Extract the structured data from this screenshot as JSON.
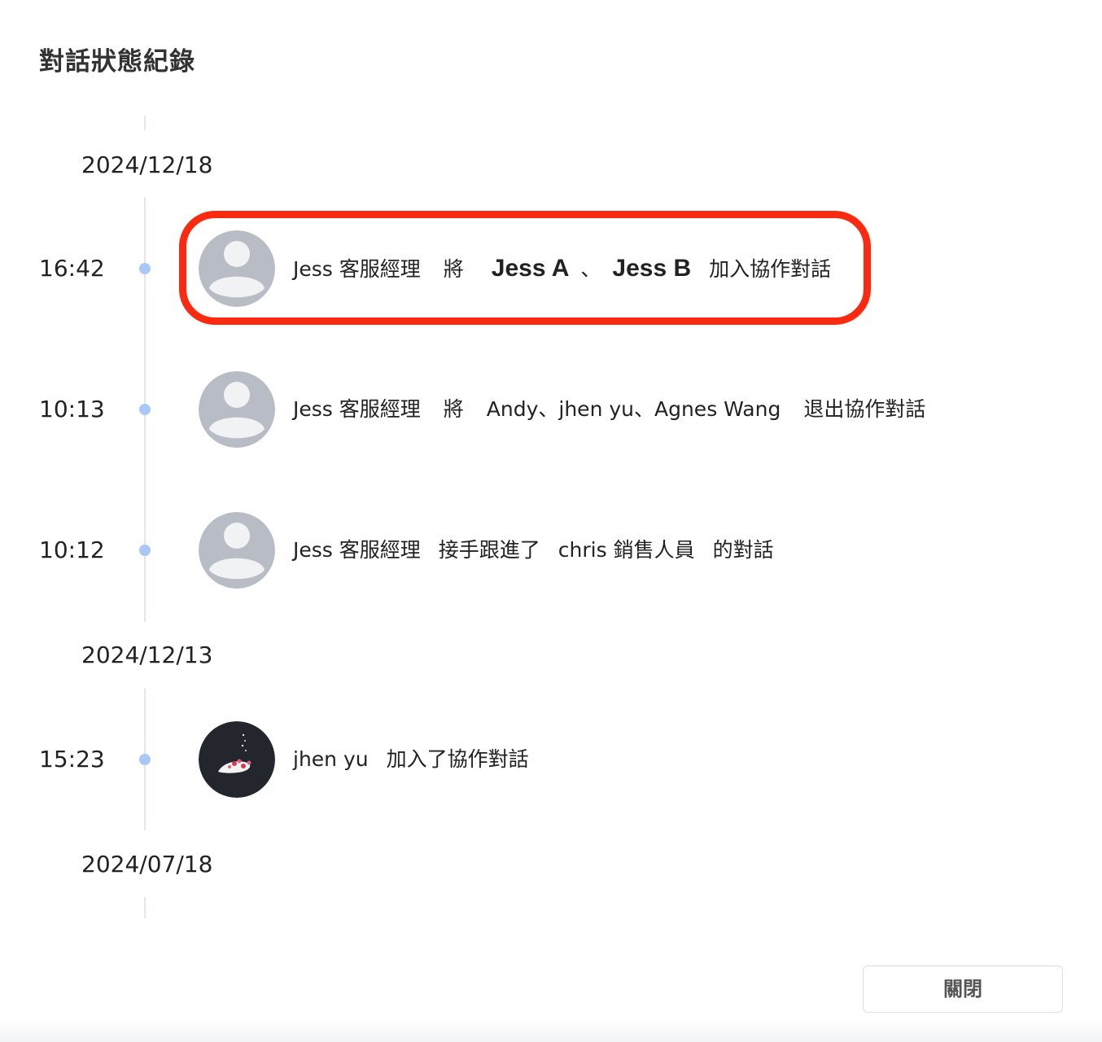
{
  "dialog": {
    "title": "對話狀態紀錄",
    "close_label": "關閉"
  },
  "groups": [
    {
      "date": "2024/12/18",
      "entries": [
        {
          "time": "16:42",
          "avatar": "default-user-avatar",
          "actor": "Jess 客服經理",
          "verb": "將",
          "target_a": "Jess A",
          "separator": "、",
          "target_b": "Jess B",
          "action": "加入協作對話",
          "highlighted": true
        },
        {
          "time": "10:13",
          "avatar": "default-user-avatar",
          "actor": "Jess 客服經理",
          "verb": "將",
          "targets": "Andy、jhen yu、Agnes Wang",
          "action": "退出協作對話"
        },
        {
          "time": "10:12",
          "avatar": "default-user-avatar",
          "actor": "Jess 客服經理",
          "verb": "接手跟進了",
          "target": "chris 銷售人員",
          "action": "的對話"
        }
      ]
    },
    {
      "date": "2024/12/13",
      "entries": [
        {
          "time": "15:23",
          "avatar": "photo-avatar",
          "actor": "jhen yu",
          "action": "加入了協作對話"
        }
      ]
    },
    {
      "date": "2024/07/18",
      "entries": []
    }
  ],
  "colors": {
    "highlight_border": "#fa2a10",
    "timeline_dot": "#a9c8f5",
    "timeline_line": "#e3e6ea",
    "avatar_bg": "#b8bcc4",
    "avatar_fg": "#f1f2f4"
  }
}
